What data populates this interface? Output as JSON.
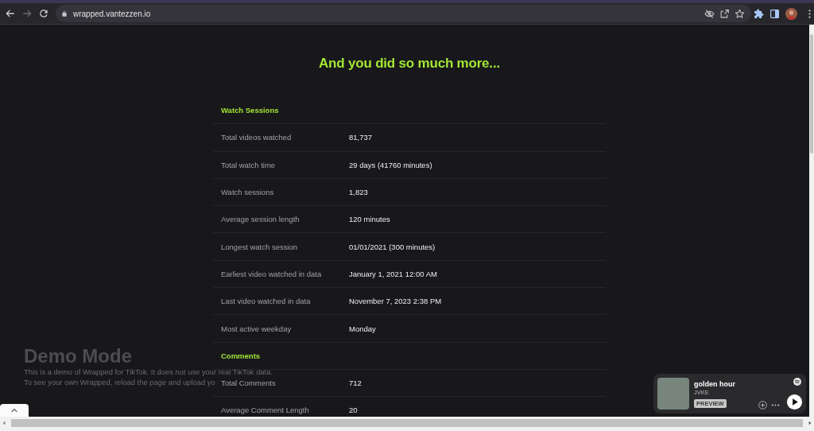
{
  "browser": {
    "url": "wrapped.vantezzen.io",
    "nav_buttons": [
      {
        "kind": "back",
        "disabled": false
      },
      {
        "kind": "forward",
        "disabled": true
      },
      {
        "kind": "reload",
        "disabled": false
      }
    ]
  },
  "page": {
    "title": "And you did so much more...",
    "sections": [
      {
        "title": "Watch Sessions",
        "rows": [
          {
            "label": "Total videos watched",
            "value": "81,737"
          },
          {
            "label": "Total watch time",
            "value": "29 days (41760 minutes)"
          },
          {
            "label": "Watch sessions",
            "value": "1,823"
          },
          {
            "label": "Average session length",
            "value": "120 minutes"
          },
          {
            "label": "Longest watch session",
            "value": "01/01/2021 (300 minutes)"
          },
          {
            "label": "Earliest video watched in data",
            "value": "January 1, 2021 12:00 AM"
          },
          {
            "label": "Last video watched in data",
            "value": "November 7, 2023 2:38 PM"
          },
          {
            "label": "Most active weekday",
            "value": "Monday"
          }
        ]
      },
      {
        "title": "Comments",
        "rows": [
          {
            "label": "Total Comments",
            "value": "712"
          },
          {
            "label": "Average Comment Length",
            "value": "20"
          }
        ]
      }
    ]
  },
  "demo_banner": {
    "title": "Demo Mode",
    "lines": [
      "This is a demo of Wrapped for TikTok. It does not use your real TikTok data.",
      "To see your own Wrapped, reload the page and upload yo"
    ]
  },
  "player": {
    "title": "golden hour",
    "artist": "JVKE",
    "badge": "PREVIEW"
  }
}
